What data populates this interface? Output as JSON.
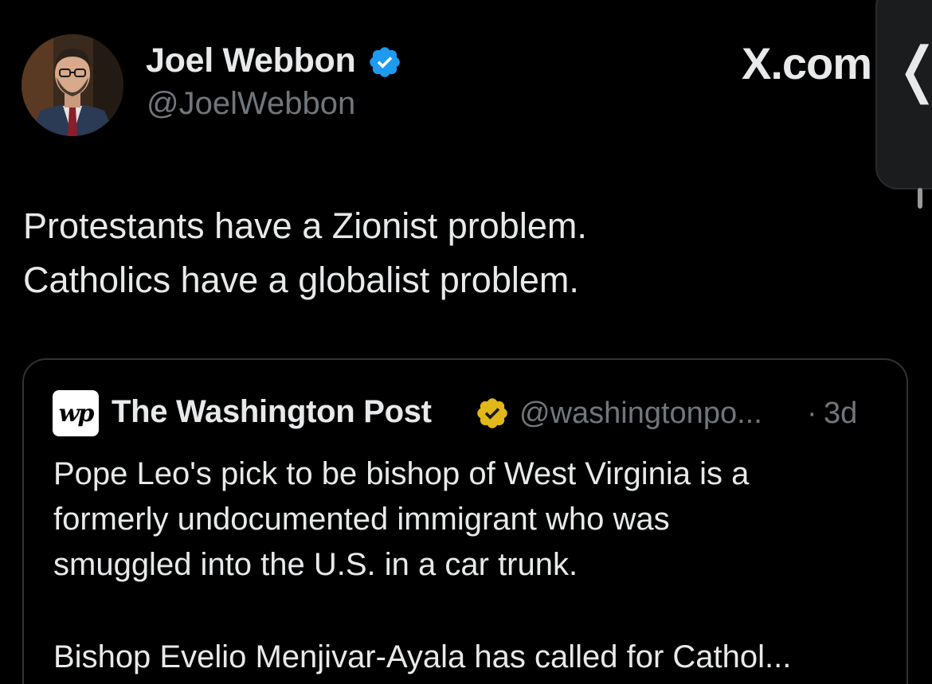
{
  "author": {
    "name": "Joel Webbon",
    "handle": "@JoelWebbon",
    "verified_color": "#1d9bf0"
  },
  "watermark": {
    "label": "X.com"
  },
  "side_panel": {
    "chevron": "❬"
  },
  "tweet": {
    "lines": [
      "Protestants have a Zionist problem.",
      "Catholics have a globalist problem."
    ]
  },
  "quoted": {
    "logo": "wp",
    "name": "The Washington Post",
    "verified_color": "#e2b719",
    "handle": "@washingtonpo...",
    "separator": "·",
    "time": "3d",
    "lines": [
      "Pope Leo's pick to be bishop of West Virginia is a",
      "formerly undocumented immigrant who was",
      "smuggled into the U.S. in a car trunk."
    ],
    "second_paragraph": "Bishop Evelio Menjivar-Ayala has called for Cathol..."
  },
  "theme": {
    "background": "#000000",
    "text_primary": "#e7e9ea",
    "text_secondary": "#71767b",
    "border": "#2f3336"
  }
}
